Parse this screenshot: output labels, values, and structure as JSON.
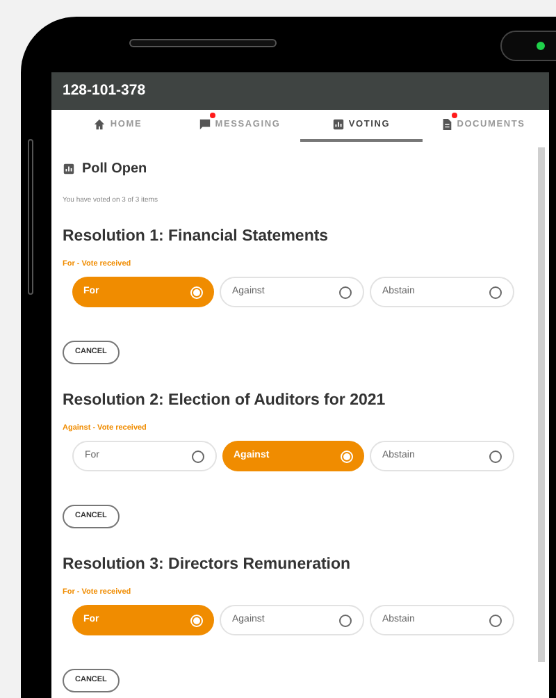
{
  "header": {
    "title": "128-101-378"
  },
  "tabs": [
    {
      "label": "HOME",
      "kind": "home",
      "badge": false,
      "selected": false
    },
    {
      "label": "MESSAGING",
      "kind": "chat",
      "badge": true,
      "selected": false
    },
    {
      "label": "VOTING",
      "kind": "chart",
      "badge": false,
      "selected": true
    },
    {
      "label": "DOCUMENTS",
      "kind": "doc",
      "badge": true,
      "selected": false
    }
  ],
  "poll": {
    "title": "Poll Open",
    "summary": "You have voted on 3 of 3 items"
  },
  "resolutions": [
    {
      "title": "Resolution 1: Financial Statements",
      "status": "For - Vote received",
      "options": [
        {
          "label": "For",
          "selected": true
        },
        {
          "label": "Against",
          "selected": false
        },
        {
          "label": "Abstain",
          "selected": false
        }
      ],
      "cancel": "CANCEL"
    },
    {
      "title": "Resolution 2: Election of Auditors for 2021",
      "status": "Against - Vote received",
      "options": [
        {
          "label": "For",
          "selected": false
        },
        {
          "label": "Against",
          "selected": true
        },
        {
          "label": "Abstain",
          "selected": false
        }
      ],
      "cancel": "CANCEL"
    },
    {
      "title": "Resolution 3: Directors Remuneration",
      "status": "For - Vote received",
      "options": [
        {
          "label": "For",
          "selected": true
        },
        {
          "label": "Against",
          "selected": false
        },
        {
          "label": "Abstain",
          "selected": false
        }
      ],
      "cancel": "CANCEL"
    }
  ]
}
